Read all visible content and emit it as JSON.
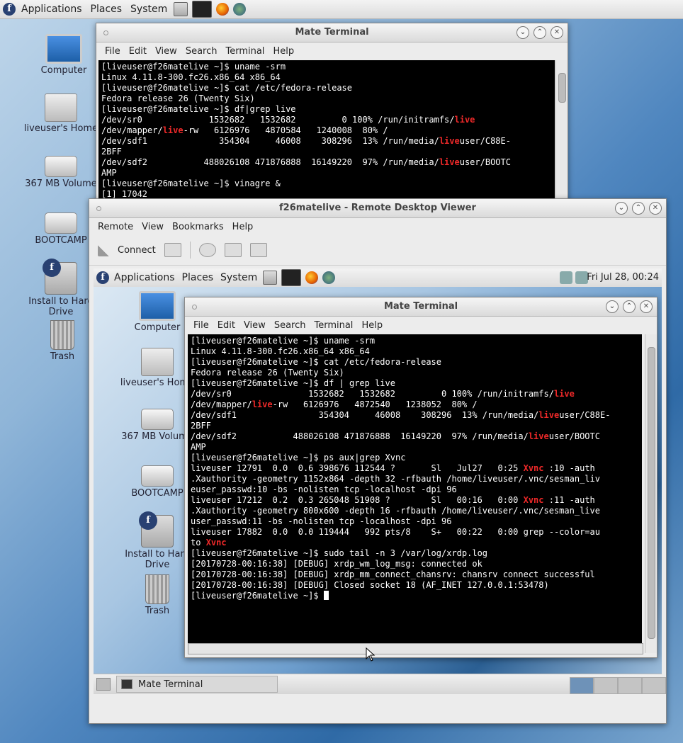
{
  "top_panel": {
    "menus": [
      "Applications",
      "Places",
      "System"
    ],
    "launchers": [
      "files-launcher-icon",
      "terminal-launcher-icon",
      "firefox-launcher-icon",
      "network-launcher-icon"
    ]
  },
  "desktop_icons": [
    {
      "label": "Computer",
      "icon": "computer-icon"
    },
    {
      "label": "liveuser's Home",
      "icon": "home-folder-icon"
    },
    {
      "label": "367 MB Volume",
      "icon": "drive-icon"
    },
    {
      "label": "BOOTCAMP",
      "icon": "drive-icon"
    },
    {
      "label": "Install to Hard Drive",
      "icon": "install-icon"
    },
    {
      "label": "Trash",
      "icon": "trash-icon"
    }
  ],
  "outer_terminal": {
    "title": "Mate Terminal",
    "menu": [
      "File",
      "Edit",
      "View",
      "Search",
      "Terminal",
      "Help"
    ],
    "lines": [
      [
        {
          "t": "[liveuser@f26matelive ~]$ uname -srm"
        }
      ],
      [
        {
          "t": "Linux 4.11.8-300.fc26.x86_64 x86_64"
        }
      ],
      [
        {
          "t": "[liveuser@f26matelive ~]$ cat /etc/fedora-release"
        }
      ],
      [
        {
          "t": "Fedora release 26 (Twenty Six)"
        }
      ],
      [
        {
          "t": "[liveuser@f26matelive ~]$ df|grep live"
        }
      ],
      [
        {
          "t": "/dev/sr0             1532682   1532682         0 100% /run/initramfs/"
        },
        {
          "t": "live",
          "hl": true
        }
      ],
      [
        {
          "t": "/dev/mapper/"
        },
        {
          "t": "live",
          "hl": true
        },
        {
          "t": "-rw   6126976   4870584   1240008  80% /"
        }
      ],
      [
        {
          "t": "/dev/sdf1              354304     46008    308296  13% /run/media/"
        },
        {
          "t": "live",
          "hl": true
        },
        {
          "t": "user/C88E-"
        }
      ],
      [
        {
          "t": "2BFF"
        }
      ],
      [
        {
          "t": "/dev/sdf2           488026108 471876888  16149220  97% /run/media/"
        },
        {
          "t": "live",
          "hl": true
        },
        {
          "t": "user/BOOTC"
        }
      ],
      [
        {
          "t": "AMP"
        }
      ],
      [
        {
          "t": "[liveuser@f26matelive ~]$ vinagre &"
        }
      ],
      [
        {
          "t": "[1] 17042"
        }
      ]
    ]
  },
  "rdv": {
    "title": "f26matelive - Remote Desktop Viewer",
    "menu": [
      "Remote",
      "View",
      "Bookmarks",
      "Help"
    ],
    "connect_label": "Connect",
    "remote_panel": {
      "menus": [
        "Applications",
        "Places",
        "System"
      ],
      "clock": "Fri Jul 28, 00:24"
    },
    "remote_icons": [
      {
        "label": "Computer",
        "icon": "computer-icon"
      },
      {
        "label": "liveuser's Home",
        "icon": "home-folder-icon"
      },
      {
        "label": "367 MB Volume",
        "icon": "drive-icon"
      },
      {
        "label": "BOOTCAMP",
        "icon": "drive-icon"
      },
      {
        "label": "Install to Hard Drive",
        "icon": "install-icon"
      },
      {
        "label": "Trash",
        "icon": "trash-icon"
      }
    ],
    "inner_terminal": {
      "title": "Mate Terminal",
      "menu": [
        "File",
        "Edit",
        "View",
        "Search",
        "Terminal",
        "Help"
      ],
      "lines": [
        [
          {
            "t": "[liveuser@f26matelive ~]$ uname -srm"
          }
        ],
        [
          {
            "t": "Linux 4.11.8-300.fc26.x86_64 x86_64"
          }
        ],
        [
          {
            "t": "[liveuser@f26matelive ~]$ cat /etc/fedora-release"
          }
        ],
        [
          {
            "t": "Fedora release 26 (Twenty Six)"
          }
        ],
        [
          {
            "t": "[liveuser@f26matelive ~]$ df | grep live"
          }
        ],
        [
          {
            "t": "/dev/sr0               1532682   1532682         0 100% /run/initramfs/"
          },
          {
            "t": "live",
            "hl": true
          }
        ],
        [
          {
            "t": "/dev/mapper/"
          },
          {
            "t": "live",
            "hl": true
          },
          {
            "t": "-rw   6126976   4872540   1238052  80% /"
          }
        ],
        [
          {
            "t": "/dev/sdf1                354304     46008    308296  13% /run/media/"
          },
          {
            "t": "live",
            "hl": true
          },
          {
            "t": "user/C88E-"
          }
        ],
        [
          {
            "t": "2BFF"
          }
        ],
        [
          {
            "t": "/dev/sdf2           488026108 471876888  16149220  97% /run/media/"
          },
          {
            "t": "live",
            "hl": true
          },
          {
            "t": "user/BOOTC"
          }
        ],
        [
          {
            "t": "AMP"
          }
        ],
        [
          {
            "t": "[liveuser@f26matelive ~]$ ps aux|grep Xvnc"
          }
        ],
        [
          {
            "t": "liveuser 12791  0.0  0.6 398676 112544 ?       Sl   Jul27   0:25 "
          },
          {
            "t": "Xvnc",
            "hl": true
          },
          {
            "t": " :10 -auth"
          }
        ],
        [
          {
            "t": ".Xauthority -geometry 1152x864 -depth 32 -rfbauth /home/liveuser/.vnc/sesman_liv"
          }
        ],
        [
          {
            "t": "euser_passwd:10 -bs -nolisten tcp -localhost -dpi 96"
          }
        ],
        [
          {
            "t": "liveuser 17212  0.2  0.3 265048 51908 ?        Sl   00:16   0:00 "
          },
          {
            "t": "Xvnc",
            "hl": true
          },
          {
            "t": " :11 -auth"
          }
        ],
        [
          {
            "t": ".Xauthority -geometry 800x600 -depth 16 -rfbauth /home/liveuser/.vnc/sesman_live"
          }
        ],
        [
          {
            "t": "user_passwd:11 -bs -nolisten tcp -localhost -dpi 96"
          }
        ],
        [
          {
            "t": "liveuser 17882  0.0  0.0 119444   992 pts/8    S+   00:22   0:00 grep --color=au"
          }
        ],
        [
          {
            "t": "to "
          },
          {
            "t": "Xvnc",
            "hl": true
          }
        ],
        [
          {
            "t": "[liveuser@f26matelive ~]$ sudo tail -n 3 /var/log/xrdp.log"
          }
        ],
        [
          {
            "t": "[20170728-00:16:38] [DEBUG] xrdp_wm_log_msg: connected ok"
          }
        ],
        [
          {
            "t": "[20170728-00:16:38] [DEBUG] xrdp_mm_connect_chansrv: chansrv connect successful"
          }
        ],
        [
          {
            "t": "[20170728-00:16:38] [DEBUG] Closed socket 18 (AF_INET 127.0.0.1:53478)"
          }
        ],
        [
          {
            "t": "[liveuser@f26matelive ~]$ "
          }
        ]
      ]
    },
    "taskbar": {
      "task_label": "Mate Terminal"
    }
  }
}
